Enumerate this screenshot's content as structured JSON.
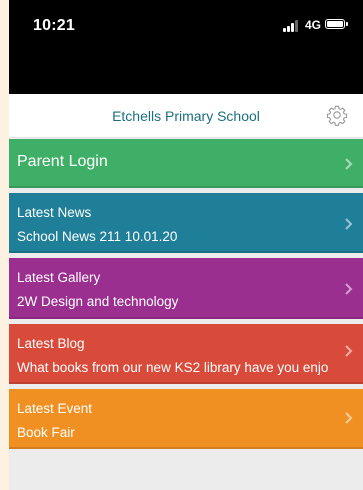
{
  "status_bar": {
    "time": "10:21",
    "network": "4G"
  },
  "header": {
    "title": "Etchells Primary School",
    "settings_icon": "gear-icon"
  },
  "login": {
    "label": "Parent Login"
  },
  "cards": [
    {
      "title": "Latest News",
      "subtitle": "School News 211 10.01.20",
      "color": "#1f7f98"
    },
    {
      "title": "Latest Gallery",
      "subtitle": "2W Design and technology",
      "color": "#9b2f90"
    },
    {
      "title": "Latest Blog",
      "subtitle": "What books from our new KS2 library have you enjo",
      "color": "#d84b3b"
    },
    {
      "title": "Latest Event",
      "subtitle": "Book Fair",
      "color": "#f09022"
    }
  ],
  "colors": {
    "login": "#3faf67",
    "header_text": "#1c6f7f"
  }
}
